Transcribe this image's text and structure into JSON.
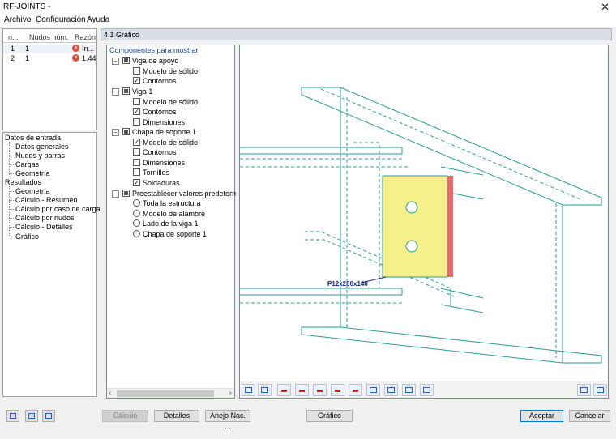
{
  "window": {
    "title": "RF-JOINTS -",
    "close_glyph": "✕"
  },
  "menu": [
    "Archivo",
    "Configuración",
    "Ayuda"
  ],
  "results_table": {
    "headers": [
      "n...",
      "Nudos núm.",
      "Razón"
    ],
    "rows": [
      {
        "n": "1",
        "nodes": "1",
        "ratio": "In..."
      },
      {
        "n": "2",
        "nodes": "1",
        "ratio": "1.44"
      }
    ]
  },
  "navigator": {
    "input_title": "Datos de entrada",
    "input_items": [
      "Datos generales",
      "Nudos y barras",
      "Cargas",
      "Geometría"
    ],
    "results_title": "Resultados",
    "results_items": [
      "Geometría",
      "Cálculo - Resumen",
      "Cálculo por caso de carga",
      "Cálculo por nudos",
      "Cálculo - Detalles",
      "Gráfico"
    ]
  },
  "section_title": "4.1 Gráfico",
  "components": {
    "title": "Componentes para mostrar",
    "groups": [
      {
        "label": "Viga de apoyo",
        "items": [
          {
            "label": "Modelo de sólido",
            "checked": false
          },
          {
            "label": "Contornos",
            "checked": true
          }
        ]
      },
      {
        "label": "Viga 1",
        "items": [
          {
            "label": "Modelo de sólido",
            "checked": false
          },
          {
            "label": "Contornos",
            "checked": true
          },
          {
            "label": "Dimensiones",
            "checked": false
          }
        ]
      },
      {
        "label": "Chapa de soporte 1",
        "items": [
          {
            "label": "Modelo de sólido",
            "checked": true
          },
          {
            "label": "Contornos",
            "checked": false
          },
          {
            "label": "Dimensiones",
            "checked": false
          },
          {
            "label": "Tornillos",
            "checked": false
          },
          {
            "label": "Soldaduras",
            "checked": true
          }
        ]
      }
    ],
    "presets_label": "Preestablecer valores predetermina",
    "presets": [
      "Toda la estructura",
      "Modelo de alambre",
      "Lado de la viga 1",
      "Chapa de soporte 1"
    ]
  },
  "graphic": {
    "plate_label": "P12x200x140"
  },
  "colors": {
    "steel": "#2a9c96",
    "plate": "#f6f08a",
    "weld": "#e86a6a",
    "label": "#1a2a8a"
  },
  "buttons": {
    "calc": "Cálculo",
    "details": "Detalles",
    "annex": "Anejo Nac. ...",
    "graphic": "Gráfico",
    "accept": "Aceptar",
    "cancel": "Cancelar"
  }
}
